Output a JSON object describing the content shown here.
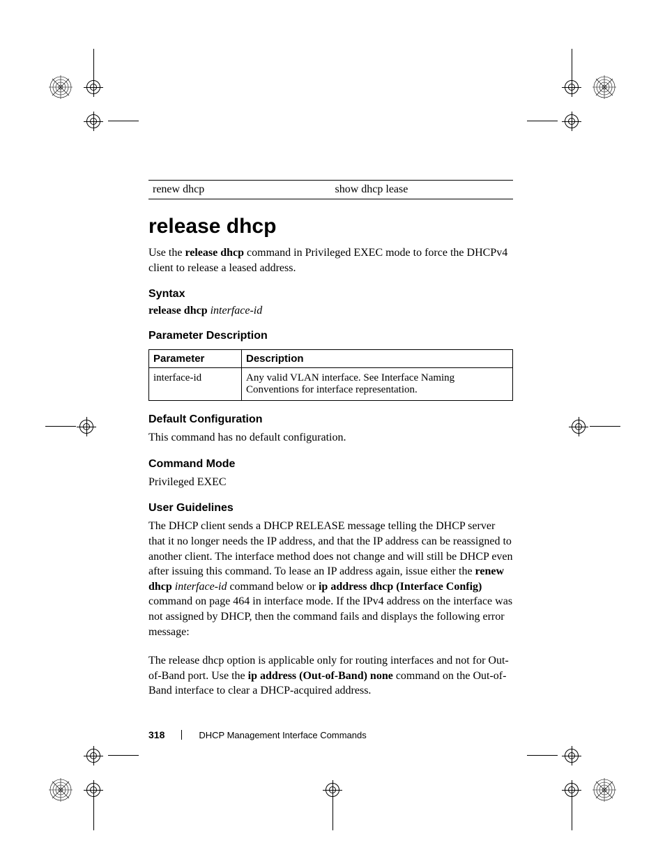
{
  "header_links": {
    "left": "renew dhcp",
    "right": "show dhcp lease"
  },
  "title": "release dhcp",
  "intro": {
    "pre": "Use the ",
    "bold": "release dhcp",
    "post": " command in Privileged EXEC mode to force the DHCPv4 client to release a leased address."
  },
  "syntax": {
    "heading": "Syntax",
    "cmd": "release dhcp",
    "arg": "interface-id"
  },
  "param": {
    "heading": "Parameter Description",
    "col1": "Parameter",
    "col2": "Description",
    "row_name": "interface-id",
    "row_desc": "Any valid VLAN interface. See Interface Naming Conventions for interface representation."
  },
  "default_cfg": {
    "heading": "Default Configuration",
    "text": "This command has no default configuration."
  },
  "mode": {
    "heading": "Command Mode",
    "text": "Privileged EXEC"
  },
  "guidelines": {
    "heading": "User Guidelines",
    "p1a": "The DHCP client sends a DHCP RELEASE message telling the DHCP server that it no longer needs the IP address, and that the IP address can be reassigned to another client.  The interface method does not change and will still be DHCP even after issuing this command.  To lease an IP address again, issue either the ",
    "p1b_bold": "renew dhcp",
    "p1c_space": " ",
    "p1d_ital": "interface-id",
    "p1e": " command below or ",
    "p1f_bold": "ip address dhcp (Interface Config)",
    "p1g": " command on page 464 in interface mode.  If the IPv4 address on the interface was not assigned by DHCP, then the command fails and displays the following error message:",
    "p2a": "The release dhcp option is applicable only for routing interfaces and not for Out-of-Band port.  Use the ",
    "p2b_bold": "ip address (Out-of-Band) none",
    "p2c": " command on the Out-of-Band interface to clear a DHCP-acquired address."
  },
  "footer": {
    "page": "318",
    "text": "DHCP Management Interface Commands"
  }
}
